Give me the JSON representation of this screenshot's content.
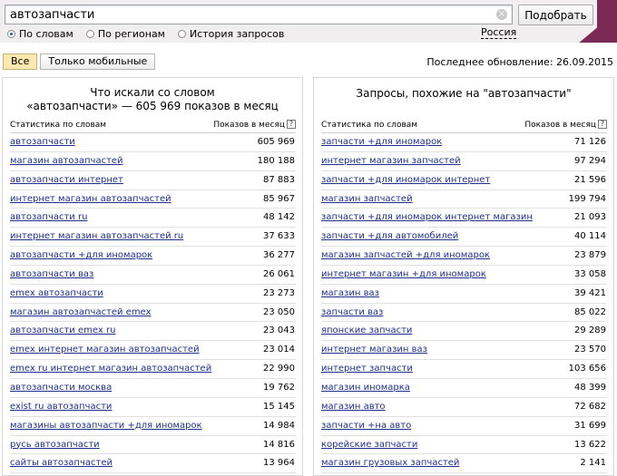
{
  "search": {
    "query": "автозапчасти",
    "clear_symbol": "×",
    "submit_label": "Подобрать",
    "modes": [
      {
        "label": "По словам",
        "checked": true
      },
      {
        "label": "По регионам",
        "checked": false
      },
      {
        "label": "История запросов",
        "checked": false
      }
    ],
    "region": "Россия"
  },
  "filters": {
    "all_label": "Все",
    "mobile_label": "Только мобильные",
    "last_update": "Последнее обновление: 26.09.2015"
  },
  "left_panel": {
    "title_line1": "Что искали со словом",
    "title_line2": "«автозапчасти» — 605 969 показов в месяц",
    "col_keywords": "Статистика по словам",
    "col_count": "Показов в месяц",
    "help_symbol": "?",
    "rows": [
      {
        "keyword": "автозапчасти",
        "count": "605 969"
      },
      {
        "keyword": "магазин автозапчастей",
        "count": "180 188"
      },
      {
        "keyword": "автозапчасти интернет",
        "count": "87 883"
      },
      {
        "keyword": "интернет магазин автозапчастей",
        "count": "85 967"
      },
      {
        "keyword": "автозапчасти ru",
        "count": "48 142"
      },
      {
        "keyword": "интернет магазин автозапчастей ru",
        "count": "37 633"
      },
      {
        "keyword": "автозапчасти +для иномарок",
        "count": "36 277"
      },
      {
        "keyword": "автозапчасти ваз",
        "count": "26 061"
      },
      {
        "keyword": "emex автозапчасти",
        "count": "23 273"
      },
      {
        "keyword": "магазин автозапчастей emex",
        "count": "23 050"
      },
      {
        "keyword": "автозапчасти emex ru",
        "count": "23 043"
      },
      {
        "keyword": "emex интернет магазин автозапчастей",
        "count": "23 014"
      },
      {
        "keyword": "emex ru интернет магазин автозапчастей",
        "count": "22 990"
      },
      {
        "keyword": "автозапчасти москва",
        "count": "19 762"
      },
      {
        "keyword": "exist ru автозапчасти",
        "count": "15 145"
      },
      {
        "keyword": "магазины автозапчасти +для иномарок",
        "count": "14 984"
      },
      {
        "keyword": "русь автозапчасти",
        "count": "14 816"
      },
      {
        "keyword": "сайты автозапчастей",
        "count": "13 964"
      }
    ]
  },
  "right_panel": {
    "title": "Запросы, похожие на \"автозапчасти\"",
    "col_keywords": "Статистика по словам",
    "col_count": "Показов в месяц",
    "help_symbol": "?",
    "rows": [
      {
        "keyword": "запчасти +для иномарок",
        "count": "71 126"
      },
      {
        "keyword": "интернет магазин запчастей",
        "count": "97 294"
      },
      {
        "keyword": "запчасти +для иномарок интернет",
        "count": "21 596"
      },
      {
        "keyword": "магазин запчастей",
        "count": "199 794"
      },
      {
        "keyword": "запчасти +для иномарок интернет магазин",
        "count": "21 093"
      },
      {
        "keyword": "запчасти +для автомобилей",
        "count": "40 114"
      },
      {
        "keyword": "магазин запчастей +для иномарок",
        "count": "23 879"
      },
      {
        "keyword": "интернет магазин +для иномарок",
        "count": "33 058"
      },
      {
        "keyword": "магазин ваз",
        "count": "39 421"
      },
      {
        "keyword": "запчасти ваз",
        "count": "85 022"
      },
      {
        "keyword": "японские запчасти",
        "count": "29 289"
      },
      {
        "keyword": "интернет магазин ваз",
        "count": "23 570"
      },
      {
        "keyword": "интернет запчасти",
        "count": "103 656"
      },
      {
        "keyword": "магазин иномарка",
        "count": "48 399"
      },
      {
        "keyword": "магазин авто",
        "count": "72 682"
      },
      {
        "keyword": "запчасти +на авто",
        "count": "31 699"
      },
      {
        "keyword": "корейские запчасти",
        "count": "13 622"
      },
      {
        "keyword": "магазин грузовых запчастей",
        "count": "2 141"
      }
    ]
  }
}
